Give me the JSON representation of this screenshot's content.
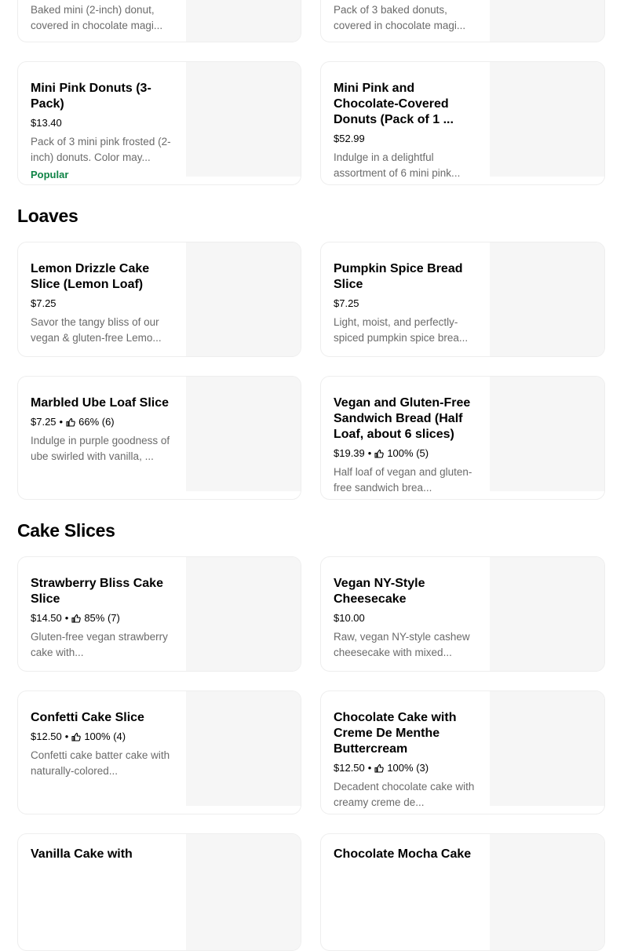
{
  "sections": {
    "loaves": "Loaves",
    "cake_slices": "Cake Slices"
  },
  "top_cards": [
    {
      "desc": "Baked mini (2-inch) donut, covered in chocolate magi..."
    },
    {
      "desc": "Pack of 3 baked donuts, covered in chocolate magi..."
    }
  ],
  "donuts": [
    {
      "name": "Mini Pink Donuts (3-Pack)",
      "price": "$13.40",
      "desc": "Pack of 3 mini pink frosted (2-inch) donuts. Color may...",
      "badge": "Popular"
    },
    {
      "name": "Mini Pink and Chocolate-Covered Donuts (Pack of 1 ...",
      "price": "$52.99",
      "desc": "Indulge in a delightful assortment of 6 mini pink..."
    }
  ],
  "loaves": [
    {
      "name": "Lemon Drizzle Cake Slice (Lemon Loaf)",
      "price": "$7.25",
      "desc": "Savor the tangy bliss of our vegan & gluten-free Lemo..."
    },
    {
      "name": "Pumpkin Spice Bread Slice",
      "price": "$7.25",
      "desc": "Light, moist, and perfectly-spiced pumpkin spice brea..."
    },
    {
      "name": "Marbled Ube Loaf Slice",
      "price": "$7.25",
      "rating": "66% (6)",
      "desc": "Indulge in purple goodness of ube swirled with vanilla, ..."
    },
    {
      "name": "Vegan and Gluten-Free Sandwich Bread (Half Loaf, about 6 slices)",
      "price": "$19.39",
      "rating": "100% (5)",
      "desc": "Half loaf of vegan and gluten-free sandwich brea..."
    }
  ],
  "cakes": [
    {
      "name": "Strawberry Bliss Cake Slice",
      "price": "$14.50",
      "rating": "85% (7)",
      "desc": "Gluten-free vegan strawberry cake with..."
    },
    {
      "name": "Vegan NY-Style Cheesecake",
      "price": "$10.00",
      "desc": "Raw, vegan NY-style cashew cheesecake with mixed..."
    },
    {
      "name": "Confetti Cake Slice",
      "price": "$12.50",
      "rating": "100% (4)",
      "desc": "Confetti cake batter cake with naturally-colored..."
    },
    {
      "name": "Chocolate Cake with Creme De Menthe Buttercream",
      "price": "$12.50",
      "rating": "100% (3)",
      "desc": "Decadent chocolate cake with creamy creme de..."
    },
    {
      "name": "Vanilla Cake with"
    },
    {
      "name": "Chocolate Mocha Cake"
    }
  ],
  "dot": "•",
  "icon": "thumbs-up-icon"
}
